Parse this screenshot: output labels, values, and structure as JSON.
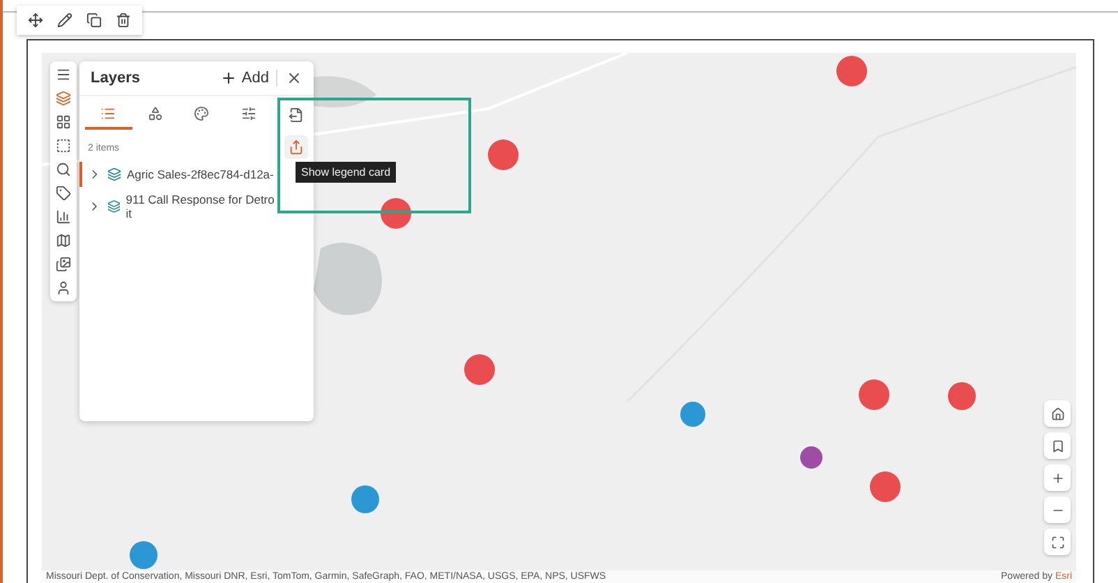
{
  "widget_toolbar": {
    "tools": [
      {
        "kind": "move"
      },
      {
        "kind": "edit"
      },
      {
        "kind": "duplicate"
      },
      {
        "kind": "delete"
      }
    ]
  },
  "map_tools": [
    {
      "kind": "menu",
      "selected": false
    },
    {
      "kind": "layers",
      "selected": true
    },
    {
      "kind": "basemap",
      "selected": false
    },
    {
      "kind": "select",
      "selected": false
    },
    {
      "kind": "search",
      "selected": false
    },
    {
      "kind": "tag",
      "selected": false
    },
    {
      "kind": "chart",
      "selected": false
    },
    {
      "kind": "map",
      "selected": false
    },
    {
      "kind": "gallery",
      "selected": false
    },
    {
      "kind": "account",
      "selected": false
    }
  ],
  "layers_panel": {
    "title": "Layers",
    "add_label": "Add",
    "tabs": [
      {
        "kind": "list",
        "selected": true
      },
      {
        "kind": "group",
        "selected": false
      },
      {
        "kind": "style",
        "selected": false
      },
      {
        "kind": "filter",
        "selected": false
      }
    ],
    "count": "2 items",
    "layers": [
      {
        "name": "Agric Sales-2f8ec784-d12a-",
        "selected": true
      },
      {
        "name": "911 Call Response for Detroit",
        "selected": false
      }
    ],
    "side_actions": [
      {
        "kind": "export",
        "highlighted": false
      },
      {
        "kind": "legend",
        "highlighted": true
      }
    ],
    "tooltip": "Show legend card"
  },
  "nav_controls": [
    {
      "kind": "home"
    },
    {
      "kind": "bookmark"
    },
    {
      "kind": "zoom-in"
    },
    {
      "kind": "zoom-out"
    },
    {
      "kind": "fullscreen"
    }
  ],
  "attribution": "Missouri Dept. of Conservation, Missouri DNR, Esri, TomTom, Garmin, SafeGraph, FAO, METI/NASA, USGS, EPA, NPS, USFWS",
  "powered_by": {
    "prefix": "Powered by",
    "brand": "Esri"
  }
}
